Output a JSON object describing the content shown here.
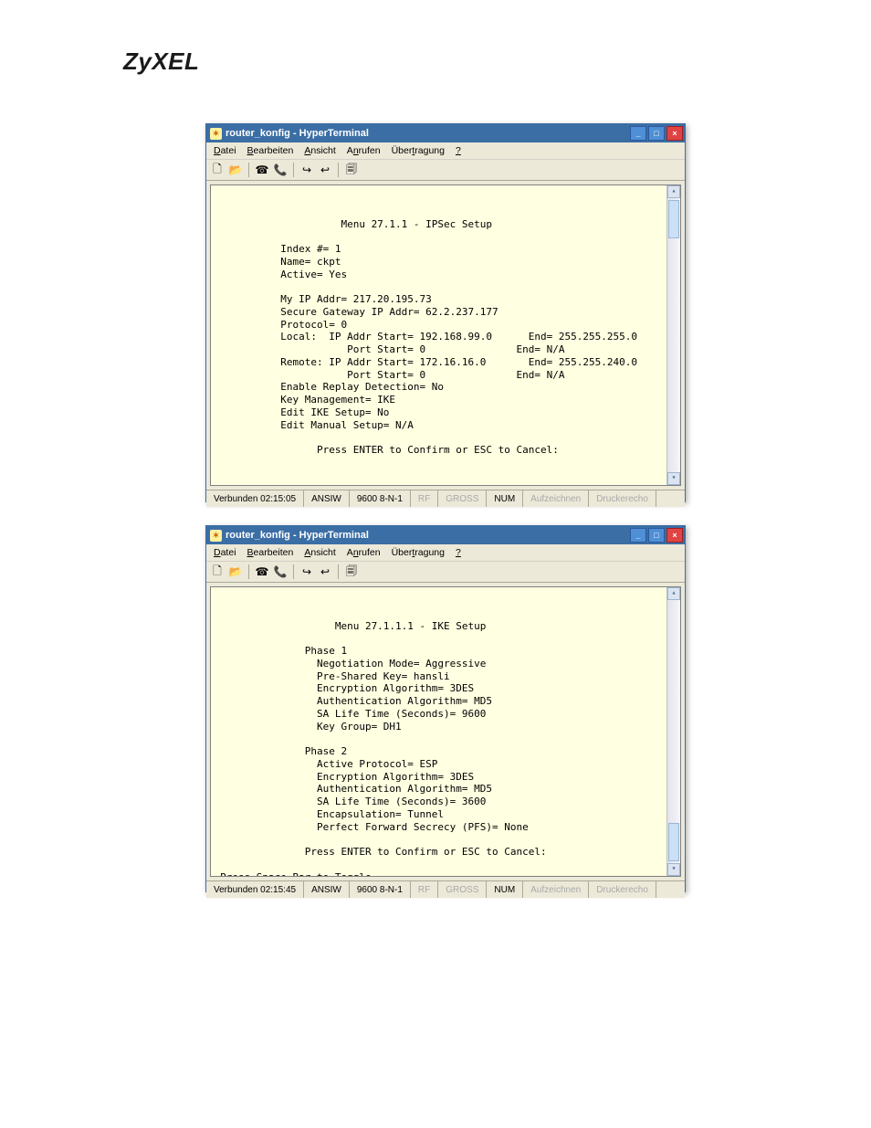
{
  "logo": "ZyXEL",
  "windows": [
    {
      "title": "router_konfig - HyperTerminal",
      "menus": {
        "m1": "Datei",
        "m2": "Bearbeiten",
        "m3": "Ansicht",
        "m4": "Anrufen",
        "m5": "Übertragung",
        "m6": "?"
      },
      "terminal_text": "                    Menu 27.1.1 - IPSec Setup\n\n          Index #= 1\n          Name= ckpt\n          Active= Yes\n\n          My IP Addr= 217.20.195.73\n          Secure Gateway IP Addr= 62.2.237.177\n          Protocol= 0\n          Local:  IP Addr Start= 192.168.99.0      End= 255.255.255.0\n                     Port Start= 0               End= N/A\n          Remote: IP Addr Start= 172.16.16.0       End= 255.255.240.0\n                     Port Start= 0               End= N/A\n          Enable Replay Detection= No\n          Key Management= IKE\n          Edit IKE Setup= No\n          Edit Manual Setup= N/A\n\n                Press ENTER to Confirm or ESC to Cancel:",
      "status": {
        "conn": "Verbunden 02:15:05",
        "emul": "ANSIW",
        "params": "9600 8-N-1",
        "s1": "RF",
        "s2": "GROSS",
        "num": "NUM",
        "s3": "Aufzeichnen",
        "s4": "Druckerecho"
      }
    },
    {
      "title": "router_konfig - HyperTerminal",
      "menus": {
        "m1": "Datei",
        "m2": "Bearbeiten",
        "m3": "Ansicht",
        "m4": "Anrufen",
        "m5": "Übertragung",
        "m6": "?"
      },
      "terminal_text": "                   Menu 27.1.1.1 - IKE Setup\n\n              Phase 1\n                Negotiation Mode= Aggressive\n                Pre-Shared Key= hansli\n                Encryption Algorithm= 3DES\n                Authentication Algorithm= MD5\n                SA Life Time (Seconds)= 9600\n                Key Group= DH1\n\n              Phase 2\n                Active Protocol= ESP\n                Encryption Algorithm= 3DES\n                Authentication Algorithm= MD5\n                SA Life Time (Seconds)= 3600\n                Encapsulation= Tunnel\n                Perfect Forward Secrecy (PFS)= None\n\n              Press ENTER to Confirm or ESC to Cancel:\n\nPress Space Bar to Toggle.",
      "status": {
        "conn": "Verbunden 02:15:45",
        "emul": "ANSIW",
        "params": "9600 8-N-1",
        "s1": "RF",
        "s2": "GROSS",
        "num": "NUM",
        "s3": "Aufzeichnen",
        "s4": "Druckerecho"
      }
    }
  ]
}
